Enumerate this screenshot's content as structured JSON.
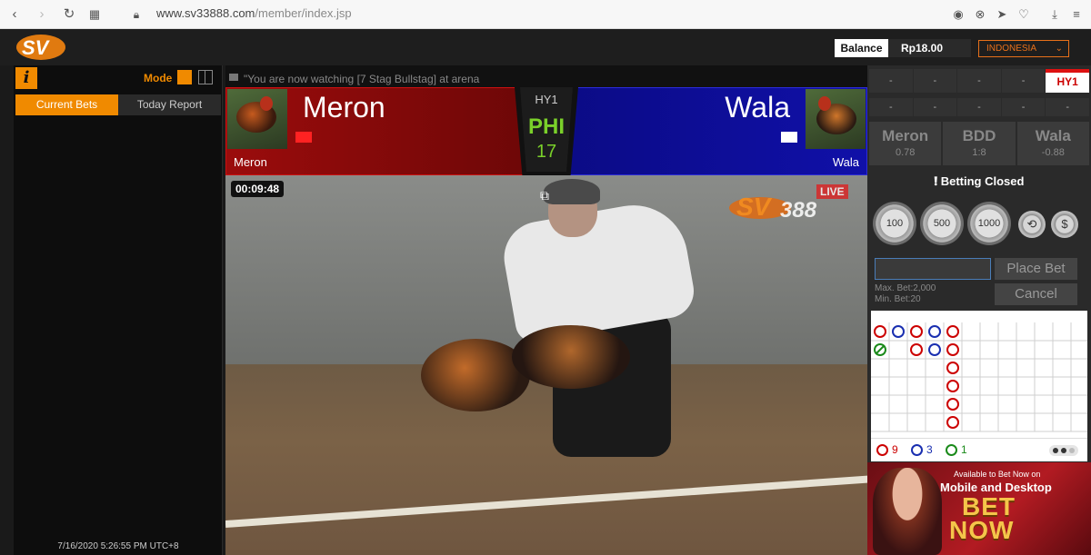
{
  "browser": {
    "url_domain": "www.sv33888.com",
    "url_path": "/member/index.jsp"
  },
  "header": {
    "balance_label": "Balance",
    "balance_value": "Rp18.00",
    "language": "INDONESIA"
  },
  "left_panel": {
    "mode_label": "Mode",
    "tabs": [
      {
        "label": "Current Bets",
        "active": true
      },
      {
        "label": "Today Report",
        "active": false
      }
    ],
    "datetime": "7/16/2020   5:26:55 PM   UTC+8"
  },
  "ticker": {
    "text": "\"You are now watching [7 Stag Bullstag] at arena"
  },
  "scoreboard": {
    "meron": {
      "title": "Meron",
      "subtitle": "Meron"
    },
    "wala": {
      "title": "Wala",
      "subtitle": "Wala"
    },
    "event_code": "HY1",
    "status": "PHI",
    "number": "17"
  },
  "video": {
    "timer": "00:09:48",
    "watermark": "SV388",
    "live_label": "LIVE"
  },
  "right_panel": {
    "hy_row1": [
      "-",
      "-",
      "-",
      "-",
      "HY1"
    ],
    "hy_row2": [
      "-",
      "-",
      "-",
      "-",
      "-"
    ],
    "odds": [
      {
        "name": "Meron",
        "value": "0.78"
      },
      {
        "name": "BDD",
        "value": "1:8"
      },
      {
        "name": "Wala",
        "value": "-0.88"
      }
    ],
    "betting_status": "Betting Closed",
    "chips": [
      "100",
      "500",
      "1000"
    ],
    "place_bet_label": "Place Bet",
    "cancel_label": "Cancel",
    "max_bet": "Max. Bet:2,000",
    "min_bet": "Min. Bet:20",
    "summary": {
      "red": "9",
      "blue": "3",
      "green": "1"
    },
    "promo": {
      "line1": "Available to Bet Now on",
      "line2": "Mobile and Desktop",
      "cta1": "BET",
      "cta2": "NOW"
    }
  },
  "colors": {
    "accent": "#f08a00",
    "meron": "#9b0c0c",
    "wala": "#1010a8",
    "status": "#7ad02a"
  }
}
